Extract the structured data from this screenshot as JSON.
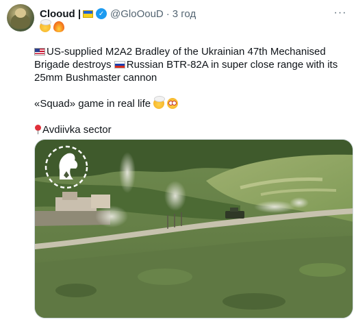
{
  "author": {
    "display_name": "Clooud |",
    "handle": "@GloOouD",
    "separator": "·",
    "time": "3 год",
    "name_emojis": [
      "exploding-head",
      "fire"
    ]
  },
  "menu": {
    "more_label": "···"
  },
  "tweet": {
    "line1_a": "US-supplied M2A2 Bradley of the Ukrainian 47th Mechanised Brigade destroys ",
    "line1_b": "Russian BTR-82A in super close range with its 25mm Bushmaster cannon",
    "line2": "«Squad» game in real life ",
    "line3": "Avdiivka sector",
    "line2_emojis": [
      "exploding-head",
      "dizzy-face"
    ],
    "line1_flags": [
      "us-flag",
      "ru-flag"
    ],
    "line3_icon": "round-pushpin"
  },
  "media": {
    "type": "image",
    "subject": "aerial drone footage"
  },
  "colors": {
    "verified": "#1d9bf0",
    "text": "#0f1419",
    "muted": "#536471",
    "ua_blue": "#1f62d4",
    "ua_yellow": "#f7d21c"
  }
}
